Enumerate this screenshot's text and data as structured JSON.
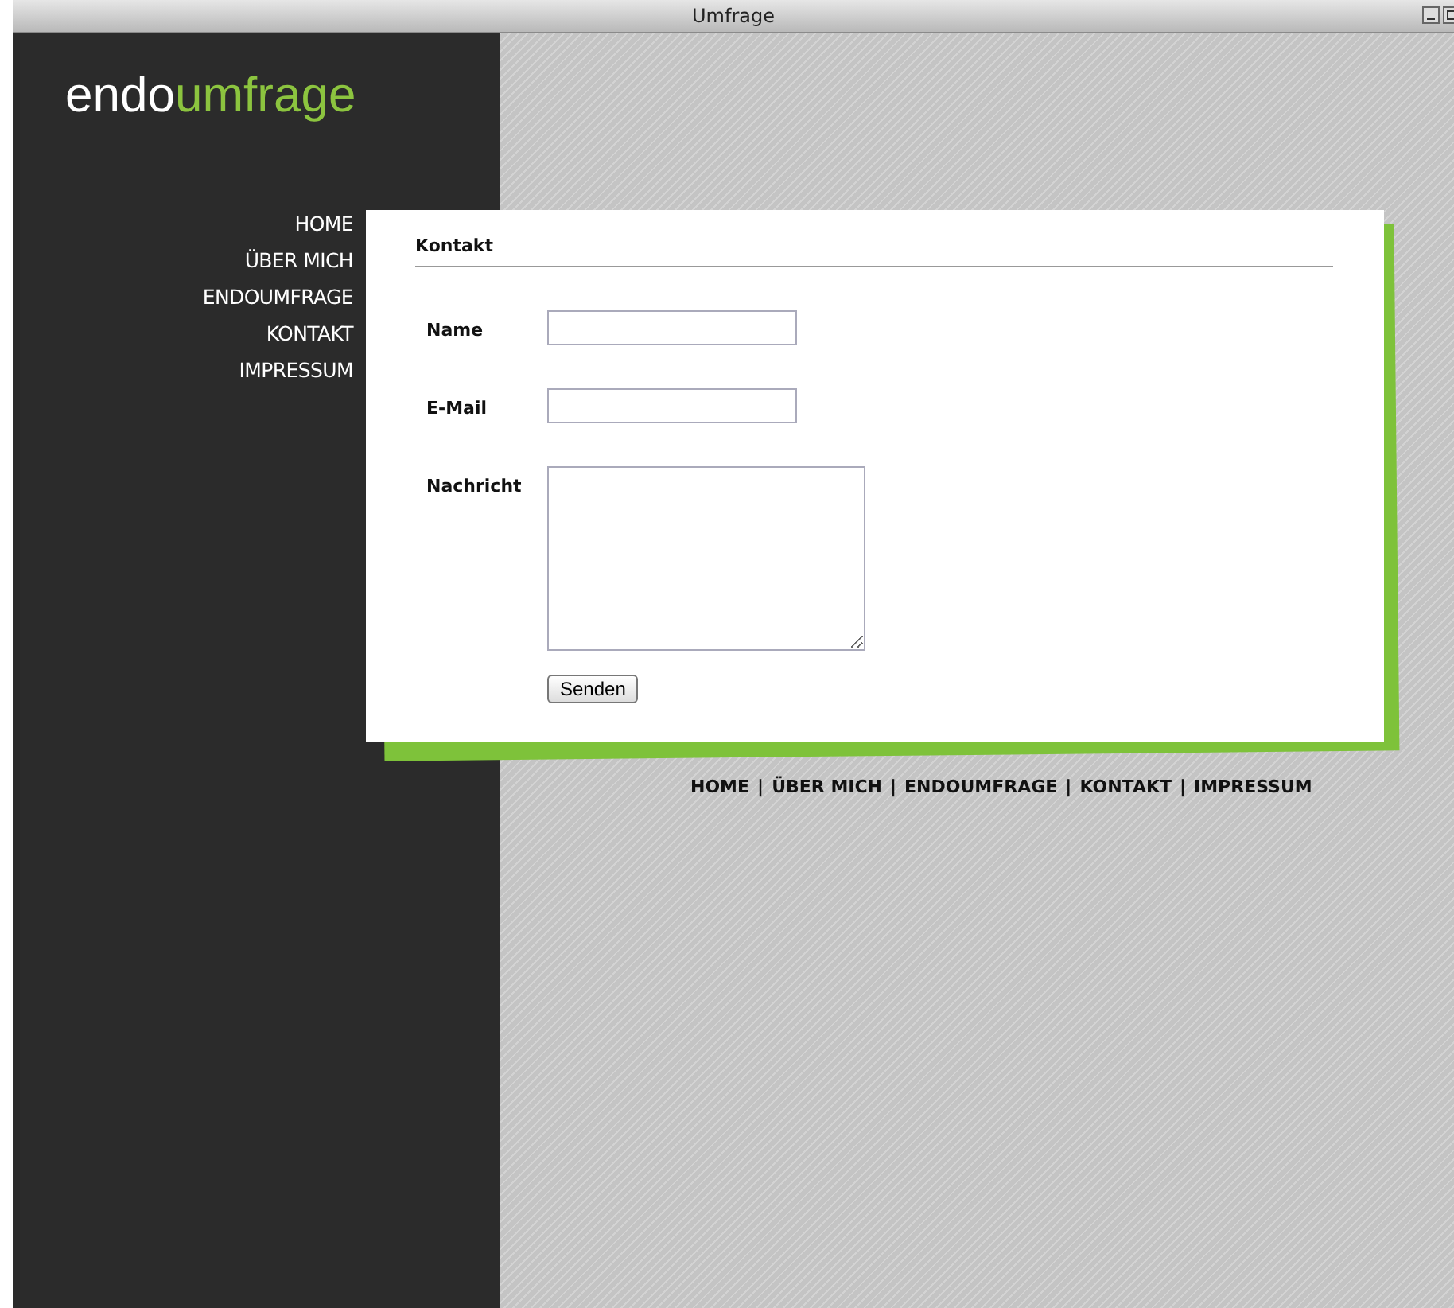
{
  "window": {
    "title": "Umfrage"
  },
  "logo": {
    "first": "endo",
    "second": "umfrage"
  },
  "nav": [
    "HOME",
    "ÜBER MICH",
    "ENDOUMFRAGE",
    "KONTAKT",
    "IMPRESSUM"
  ],
  "form": {
    "heading": "Kontakt",
    "fields": [
      {
        "label": "Name",
        "kind": "input"
      },
      {
        "label": "E-Mail",
        "kind": "input"
      },
      {
        "label": "Nachricht",
        "kind": "textarea"
      }
    ],
    "submit": "Senden"
  },
  "footer": {
    "separator": "|",
    "links": [
      "HOME",
      "ÜBER MICH",
      "ENDOUMFRAGE",
      "KONTAKT",
      "IMPRESSUM"
    ]
  }
}
